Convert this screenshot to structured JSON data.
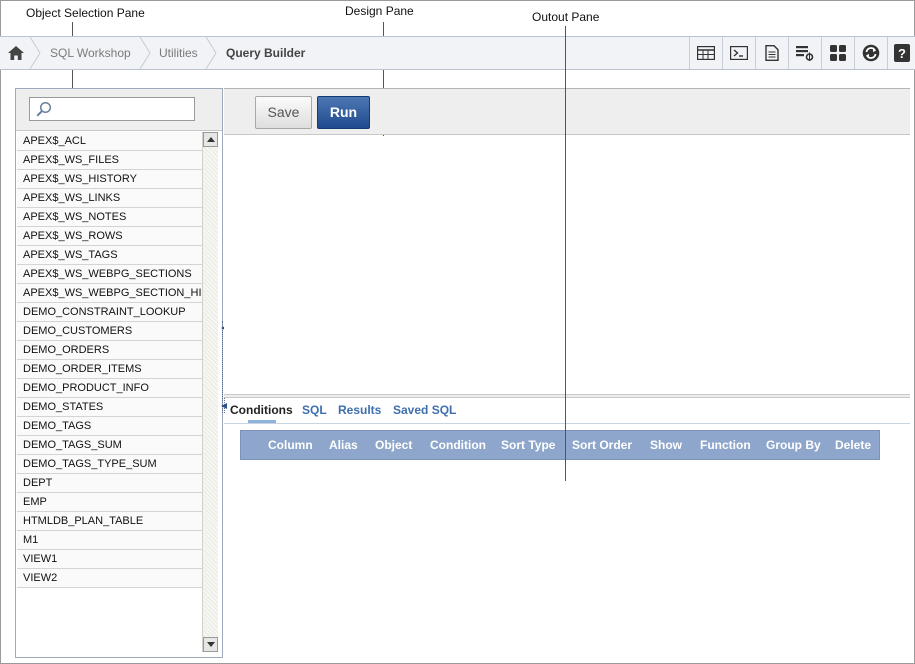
{
  "callouts": {
    "object_selection": "Object Selection Pane",
    "design": "Design Pane",
    "output": "Outout Pane"
  },
  "breadcrumb": {
    "items": [
      "SQL Workshop",
      "Utilities"
    ],
    "current": "Query Builder"
  },
  "toolbar_icons": [
    "object-browser-icon",
    "sql-commands-icon",
    "sql-scripts-icon",
    "query-builder-icon",
    "utilities-icon",
    "sync-icon",
    "help-icon"
  ],
  "search": {
    "value": "",
    "placeholder": ""
  },
  "objects": [
    "APEX$_ACL",
    "APEX$_WS_FILES",
    "APEX$_WS_HISTORY",
    "APEX$_WS_LINKS",
    "APEX$_WS_NOTES",
    "APEX$_WS_ROWS",
    "APEX$_WS_TAGS",
    "APEX$_WS_WEBPG_SECTIONS",
    "APEX$_WS_WEBPG_SECTION_HISTC",
    "DEMO_CONSTRAINT_LOOKUP",
    "DEMO_CUSTOMERS",
    "DEMO_ORDERS",
    "DEMO_ORDER_ITEMS",
    "DEMO_PRODUCT_INFO",
    "DEMO_STATES",
    "DEMO_TAGS",
    "DEMO_TAGS_SUM",
    "DEMO_TAGS_TYPE_SUM",
    "DEPT",
    "EMP",
    "HTMLDB_PLAN_TABLE",
    "M1",
    "VIEW1",
    "VIEW2"
  ],
  "buttons": {
    "save": "Save",
    "run": "Run"
  },
  "tabs": [
    "Conditions",
    "SQL",
    "Results",
    "Saved SQL"
  ],
  "active_tab": "Conditions",
  "conditions_columns": [
    "Column",
    "Alias",
    "Object",
    "Condition",
    "Sort Type",
    "Sort Order",
    "Show",
    "Function",
    "Group By",
    "Delete"
  ],
  "colors": {
    "run_button": "#1f4b8e",
    "tab_link": "#3e6fae",
    "header_bar": "#8ea6cb"
  }
}
